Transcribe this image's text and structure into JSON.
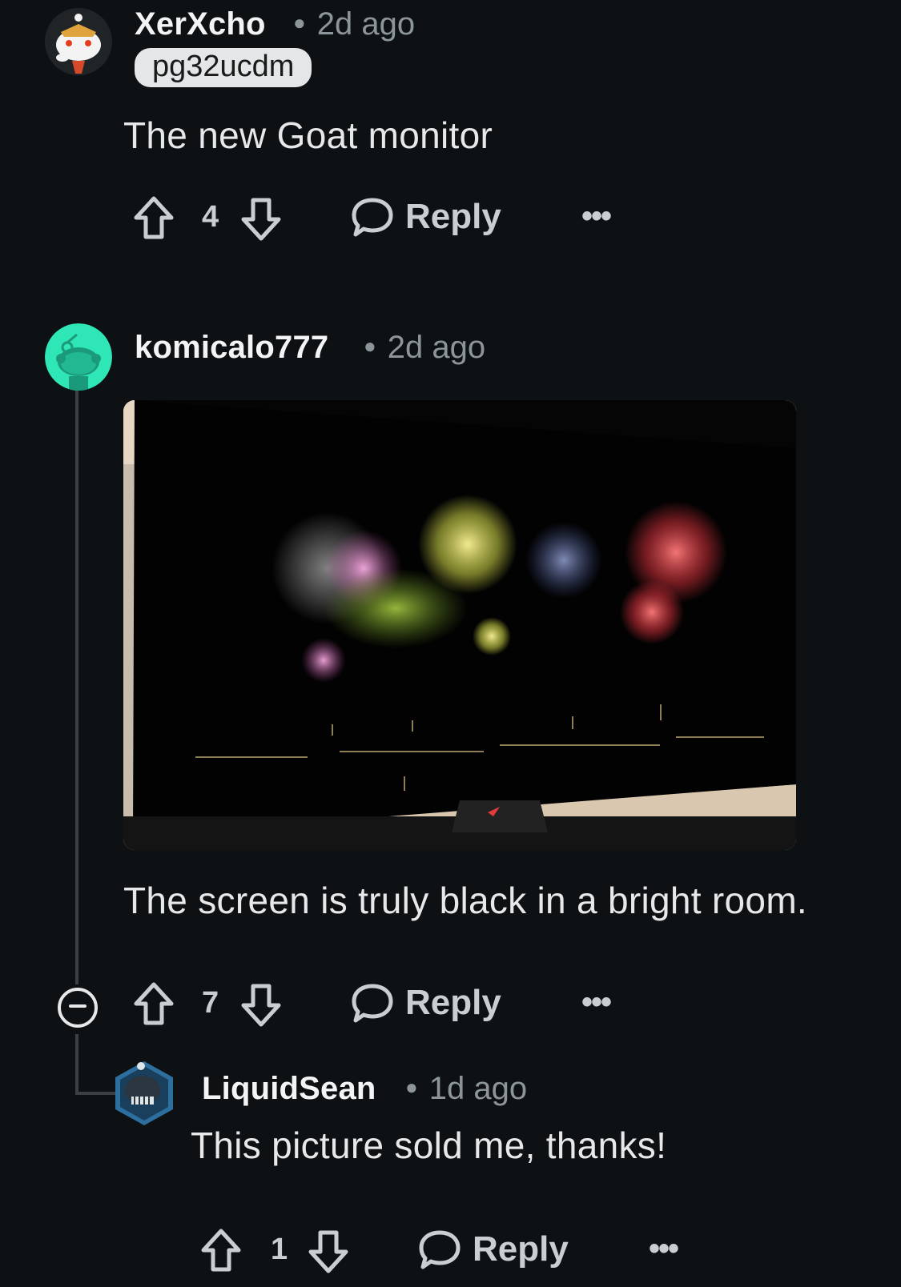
{
  "comments": [
    {
      "username": "XerXcho",
      "time": "2d ago",
      "flair": "pg32ucdm",
      "text": "The new Goat monitor",
      "votes": "4",
      "reply_label": "Reply",
      "more_label": "•••"
    },
    {
      "username": "komicalo777",
      "time": "2d ago",
      "text": "The screen is truly black in a bright room.",
      "votes": "7",
      "reply_label": "Reply",
      "more_label": "•••"
    },
    {
      "username": "LiquidSean",
      "time": "1d ago",
      "text": "This picture sold me, thanks!",
      "votes": "1",
      "reply_label": "Reply",
      "more_label": "•••"
    }
  ],
  "colors": {
    "background": "#0e1113",
    "text": "#d7dadc",
    "meta": "#8c9599",
    "flair_bg": "#e4e6e8",
    "avatar_teal": "#2ee6b6"
  },
  "icons": [
    "upvote-icon",
    "downvote-icon",
    "reply-bubble-icon",
    "more-options-icon",
    "collapse-thread-icon"
  ]
}
